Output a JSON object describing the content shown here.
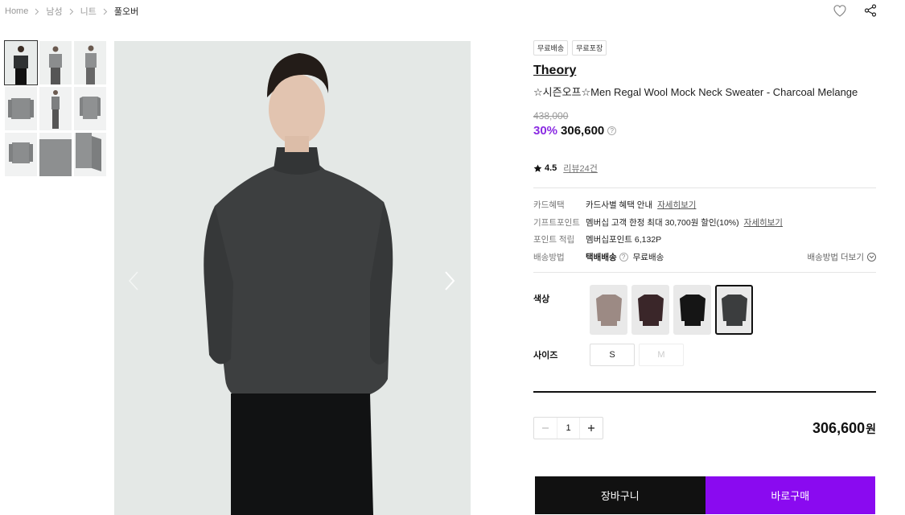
{
  "breadcrumb": {
    "items": [
      "Home",
      "남성",
      "니트",
      "풀오버"
    ]
  },
  "icons": {
    "wishlist": "heart-icon",
    "share": "share-icon"
  },
  "gallery": {
    "thumbnail_count": 9,
    "active_index": 0
  },
  "product": {
    "badges": [
      "무료배송",
      "무료포장"
    ],
    "brand": "Theory",
    "name": "☆시즌오프☆Men Regal Wool Mock Neck Sweater - Charcoal Melange",
    "original_price": "438,000",
    "discount": "30%",
    "sale_price": "306,600",
    "rating": "4.5",
    "review_link": "리뷰24건"
  },
  "benefits": {
    "card_label": "카드혜택",
    "card_value": "카드사별 혜택 안내",
    "card_link": "자세히보기",
    "gift_label": "기프트포인트",
    "gift_value": "멤버십 고객 한정 최대 30,700원 할인(10%)",
    "gift_link": "자세히보기",
    "point_label": "포인트 적립",
    "point_value": "멤버십포인트 6,132P",
    "shipping_label": "배송방법",
    "shipping_method": "택배배송",
    "shipping_fee": "무료배송",
    "shipping_more": "배송방법 더보기"
  },
  "options": {
    "color_label": "색상",
    "colors": [
      {
        "color": "#9c8a84",
        "selected": false
      },
      {
        "color": "#3a2629",
        "selected": false
      },
      {
        "color": "#151515",
        "selected": false
      },
      {
        "color": "#3b3d3e",
        "selected": true
      }
    ],
    "size_label": "사이즈",
    "sizes": [
      {
        "label": "S",
        "disabled": false
      },
      {
        "label": "M",
        "disabled": true
      }
    ]
  },
  "order": {
    "quantity": "1",
    "total": "306,600",
    "currency": "원",
    "cart_label": "장바구니",
    "buy_label": "바로구매"
  },
  "colors": {
    "accent": "#8a0af0",
    "discount": "#8a2be2"
  }
}
